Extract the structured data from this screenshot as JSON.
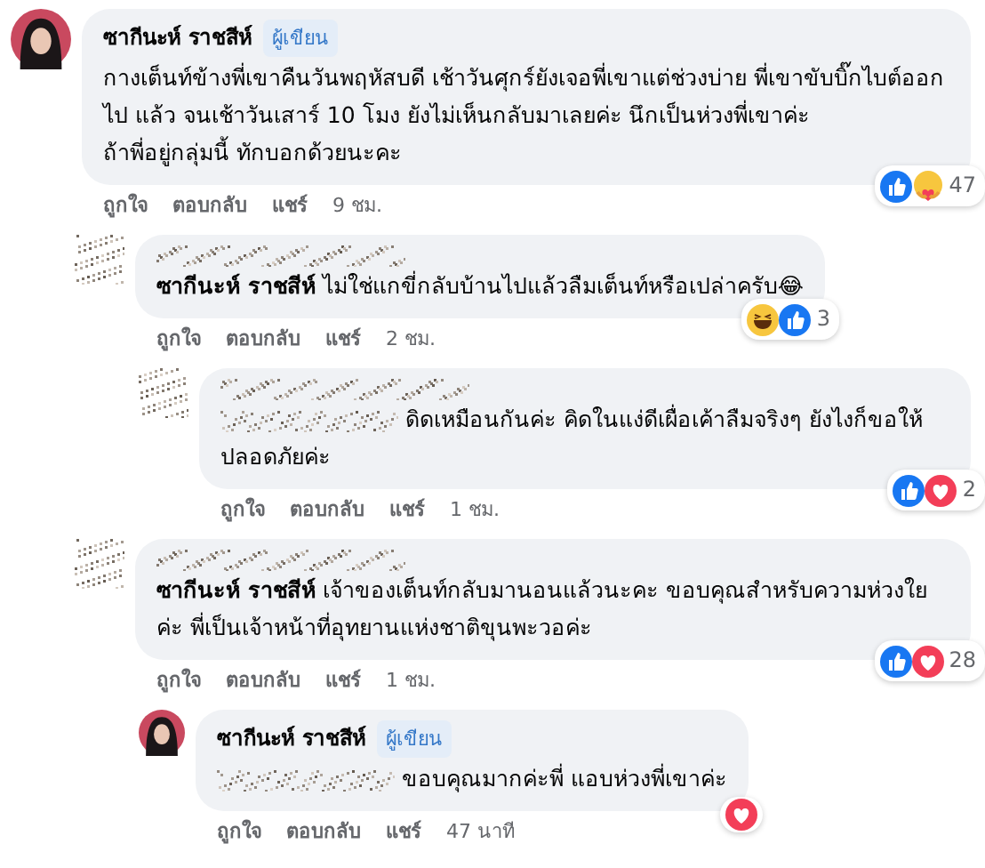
{
  "comments": [
    {
      "avatar": {
        "kind": "photo"
      },
      "author": "ซากีนะห์ ราชสีห์",
      "badge": "ผู้เขียน",
      "paragraphs": [
        "กางเต็นท์ข้างพี่เขาคืนวันพฤหัสบดี เช้าวันศุกร์ยังเจอพี่เขาแต่ช่วงบ่าย พี่เขาขับบิ๊กไบต์ออกไป แล้ว จนเช้าวันเสาร์ 10 โมง ยังไม่เห็นกลับมาเลยค่ะ นึกเป็นห่วงพี่เขาค่ะ",
        "ถ้าพี่อยู่กลุ่มนี้ ทักบอกด้วยนะคะ"
      ],
      "reactions": [
        {
          "kind": "like"
        },
        {
          "kind": "care"
        }
      ],
      "reaction_count": "47",
      "actions": [
        "ถูกใจ",
        "ตอบกลับ",
        "แชร์"
      ],
      "time": "9 ชม.",
      "children": [
        {
          "avatar": {
            "kind": "blurred"
          },
          "mention": "ซากีนะห์ ราชสีห์",
          "paragraphs": [
            "ไม่ใช่แกขี่กลับบ้านไปแล้วลืมเต็นท์หรือเปล่าครับ😂"
          ],
          "reactions": [
            {
              "kind": "haha"
            },
            {
              "kind": "like"
            }
          ],
          "reaction_count": "3",
          "actions": [
            "ถูกใจ",
            "ตอบกลับ",
            "แชร์"
          ],
          "time": "2 ชม.",
          "children": [
            {
              "avatar": {
                "kind": "blurred"
              },
              "mention_blurred": true,
              "paragraphs": [
                "ดิดเหมือนกันค่ะ คิดในแง่ดีเผื่อเค้าลืมจริงๆ ยังไงก็ขอให้ปลอดภัยค่ะ"
              ],
              "reactions": [
                {
                  "kind": "like"
                },
                {
                  "kind": "love"
                }
              ],
              "reaction_count": "2",
              "actions": [
                "ถูกใจ",
                "ตอบกลับ",
                "แชร์"
              ],
              "time": "1 ชม."
            }
          ]
        },
        {
          "avatar": {
            "kind": "blurred"
          },
          "mention": "ซากีนะห์ ราชสีห์",
          "paragraphs": [
            "เจ้าของเต็นท์กลับมานอนแล้วนะคะ ขอบคุณสำหรับความห่วงใยค่ะ พี่เป็นเจ้าหน้าที่อุทยานแห่งชาติขุนพะวอค่ะ"
          ],
          "reactions": [
            {
              "kind": "like"
            },
            {
              "kind": "love"
            }
          ],
          "reaction_count": "28",
          "actions": [
            "ถูกใจ",
            "ตอบกลับ",
            "แชร์"
          ],
          "time": "1 ชม.",
          "children": [
            {
              "avatar": {
                "kind": "photo"
              },
              "author": "ซากีนะห์ ราชสีห์",
              "badge": "ผู้เขียน",
              "mention_blurred": true,
              "paragraphs": [
                "ขอบคุณมากค่ะพี่ แอบห่วงพี่เขาค่ะ"
              ],
              "reactions": [
                {
                  "kind": "love"
                }
              ],
              "actions": [
                "ถูกใจ",
                "ตอบกลับ",
                "แชร์"
              ],
              "time": "47 นาที"
            }
          ]
        }
      ]
    }
  ]
}
